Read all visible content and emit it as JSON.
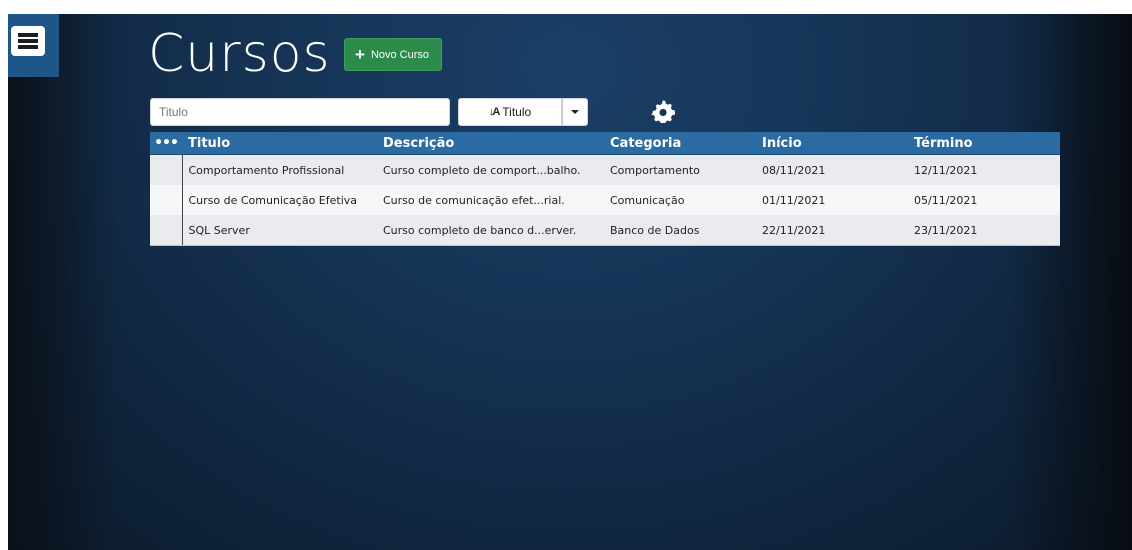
{
  "page": {
    "title": "Cursos",
    "new_button_label": "Novo Curso"
  },
  "toolbar": {
    "search_placeholder": "Titulo",
    "sort_label": "Titulo"
  },
  "table": {
    "headers": {
      "options": "•••",
      "titulo": "Titulo",
      "descricao": "Descrição",
      "categoria": "Categoria",
      "inicio": "Início",
      "termino": "Término"
    },
    "rows": [
      {
        "titulo": "Comportamento Profissional",
        "descricao": "Curso completo de comport...balho.",
        "categoria": "Comportamento",
        "inicio": "08/11/2021",
        "termino": "12/11/2021"
      },
      {
        "titulo": "Curso de Comunicação Efetiva",
        "descricao": "Curso de comunicação efet...rial.",
        "categoria": "Comunicação",
        "inicio": "01/11/2021",
        "termino": "05/11/2021"
      },
      {
        "titulo": "SQL Server",
        "descricao": "Curso completo de banco d...erver.",
        "categoria": "Banco de Dados",
        "inicio": "22/11/2021",
        "termino": "23/11/2021"
      }
    ]
  },
  "icons": {
    "menu": "hamburger-icon",
    "plus": "plus-icon",
    "sort": "sort-alpha-icon",
    "dropdown": "caret-down-icon",
    "settings": "gear-icon"
  },
  "colors": {
    "accent": "#2c6ba1",
    "new_button": "#2c8a4a",
    "menu_button": "#1e5689"
  }
}
